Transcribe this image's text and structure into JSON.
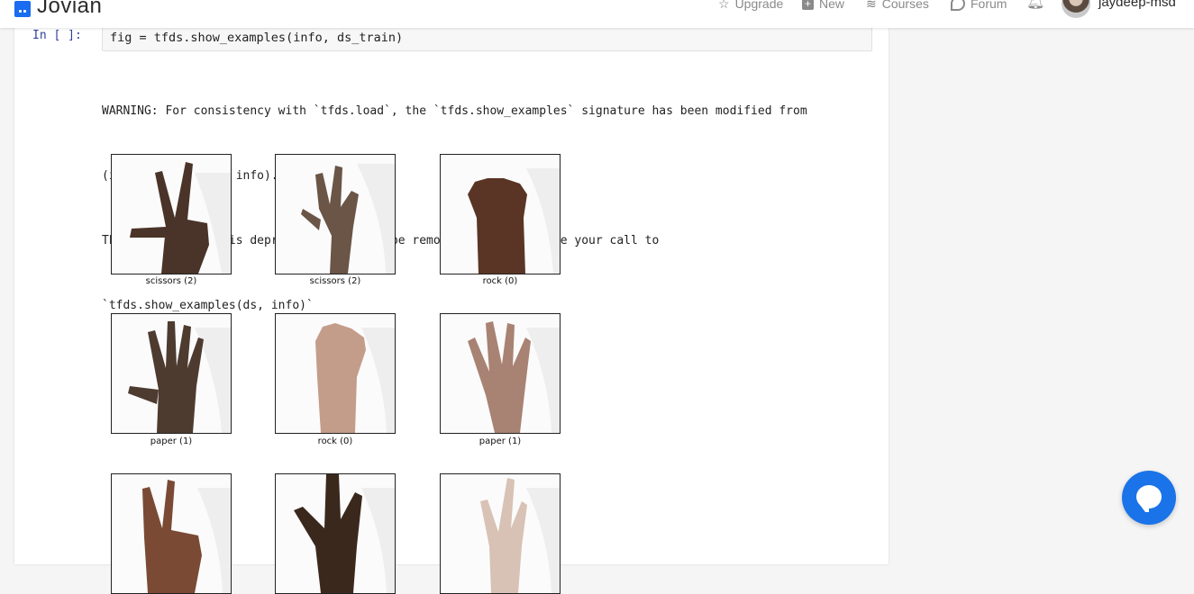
{
  "header": {
    "brand": "Jovian",
    "nav": [
      {
        "label": "Upgrade",
        "icon": "star-icon"
      },
      {
        "label": "New",
        "icon": "plus-icon"
      },
      {
        "label": "Courses",
        "icon": "courses-icon"
      },
      {
        "label": "Forum",
        "icon": "forum-icon"
      }
    ],
    "notifications_icon": "bell-icon",
    "username": "jaydeep-msd"
  },
  "cell": {
    "prompt": "In [ ]:",
    "code": "fig = tfds.show_examples(info, ds_train)",
    "output_lines": [
      "WARNING: For consistency with `tfds.load`, the `tfds.show_examples` signature has been modified from",
      "(info, ds) to (ds, info).",
      "The old signature is deprecated and will be removed. Please change your call to",
      "`tfds.show_examples(ds, info)`"
    ]
  },
  "examples": [
    {
      "caption": "scissors (2)",
      "tone": "#4a3328"
    },
    {
      "caption": "scissors (2)",
      "tone": "#6a5547"
    },
    {
      "caption": "rock (0)",
      "tone": "#5a3525"
    },
    {
      "caption": "paper (1)",
      "tone": "#4e3b30"
    },
    {
      "caption": "rock (0)",
      "tone": "#c49d8a"
    },
    {
      "caption": "paper (1)",
      "tone": "#a88272"
    },
    {
      "caption": "",
      "tone": "#7a4a35"
    },
    {
      "caption": "",
      "tone": "#3b281d"
    },
    {
      "caption": "",
      "tone": "#d8c2b5"
    }
  ],
  "chat": {
    "icon": "chat-bubble-icon"
  }
}
